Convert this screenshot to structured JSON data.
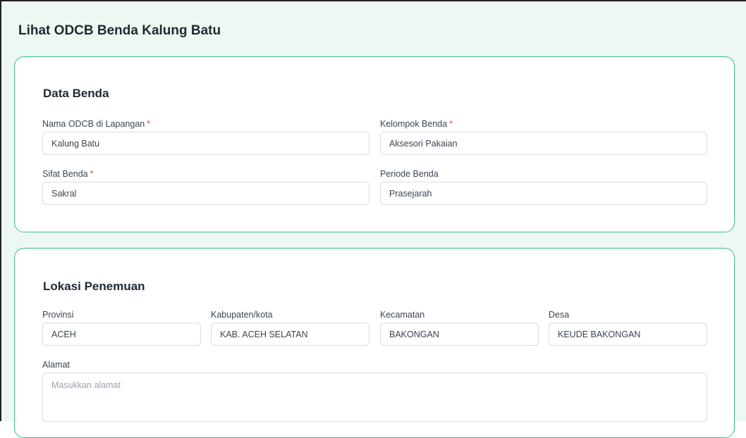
{
  "page": {
    "title": "Lihat ODCB Benda Kalung Batu"
  },
  "data_benda": {
    "section_title": "Data Benda",
    "nama": {
      "label": "Nama ODCB di Lapangan",
      "required_mark": "*",
      "value": "Kalung Batu"
    },
    "kelompok": {
      "label": "Kelompok Benda",
      "required_mark": "*",
      "value": "Aksesori Pakaian"
    },
    "sifat": {
      "label": "Sifat Benda",
      "required_mark": "*",
      "value": "Sakral"
    },
    "periode": {
      "label": "Periode Benda",
      "value": "Prasejarah"
    }
  },
  "lokasi": {
    "section_title": "Lokasi Penemuan",
    "provinsi": {
      "label": "Provinsi",
      "value": "ACEH"
    },
    "kabupaten": {
      "label": "Kabupaten/kota",
      "value": "KAB. ACEH SELATAN"
    },
    "kecamatan": {
      "label": "Kecamatan",
      "value": "BAKONGAN"
    },
    "desa": {
      "label": "Desa",
      "value": "KEUDE BAKONGAN"
    },
    "alamat": {
      "label": "Alamat",
      "value": "",
      "placeholder": "Masukkan alamat"
    }
  },
  "colors": {
    "page_background": "#eef8f3",
    "card_border": "#35c08f",
    "required_mark": "#e5484d",
    "input_border": "#d6dbe1"
  }
}
